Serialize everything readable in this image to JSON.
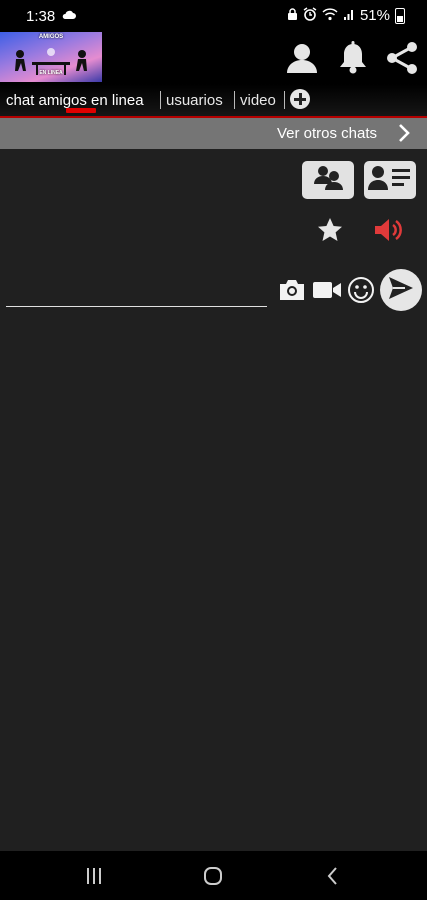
{
  "status_bar": {
    "time": "1:38",
    "cloud_icon": "cloud-icon",
    "battery": "51%",
    "icons": [
      "lock-icon",
      "alarm-icon",
      "wifi-icon",
      "signal-icon",
      "battery-icon"
    ]
  },
  "header": {
    "logo_title": "AMIGOS",
    "logo_subtitle": "EN LINEA",
    "icons": [
      "user-icon",
      "bell-icon",
      "share-icon"
    ]
  },
  "tabs": {
    "items": [
      {
        "label": "chat amigos en linea",
        "active": true
      },
      {
        "label": "usuarios",
        "active": false
      },
      {
        "label": "video",
        "active": false
      }
    ],
    "add_icon": "plus-circle-icon"
  },
  "chats_bar": {
    "label": "Ver otros chats",
    "icon": "chevron-right-icon"
  },
  "toolbar": {
    "buttons": [
      "users-group-icon",
      "user-card-icon"
    ],
    "star_icon": "star-icon",
    "sound_icon": "volume-icon"
  },
  "composer": {
    "message_value": "",
    "icons": [
      "camera-icon",
      "video-camera-icon",
      "smiley-icon",
      "send-icon"
    ]
  },
  "nav": {
    "icons": [
      "recent-apps-icon",
      "home-icon",
      "back-icon"
    ]
  },
  "colors": {
    "tab_underline": "#b40000",
    "tab_indicator": "#e00000",
    "sound_icon": "#e03a3a",
    "chats_bar": "#757575",
    "main_bg": "#202020"
  }
}
